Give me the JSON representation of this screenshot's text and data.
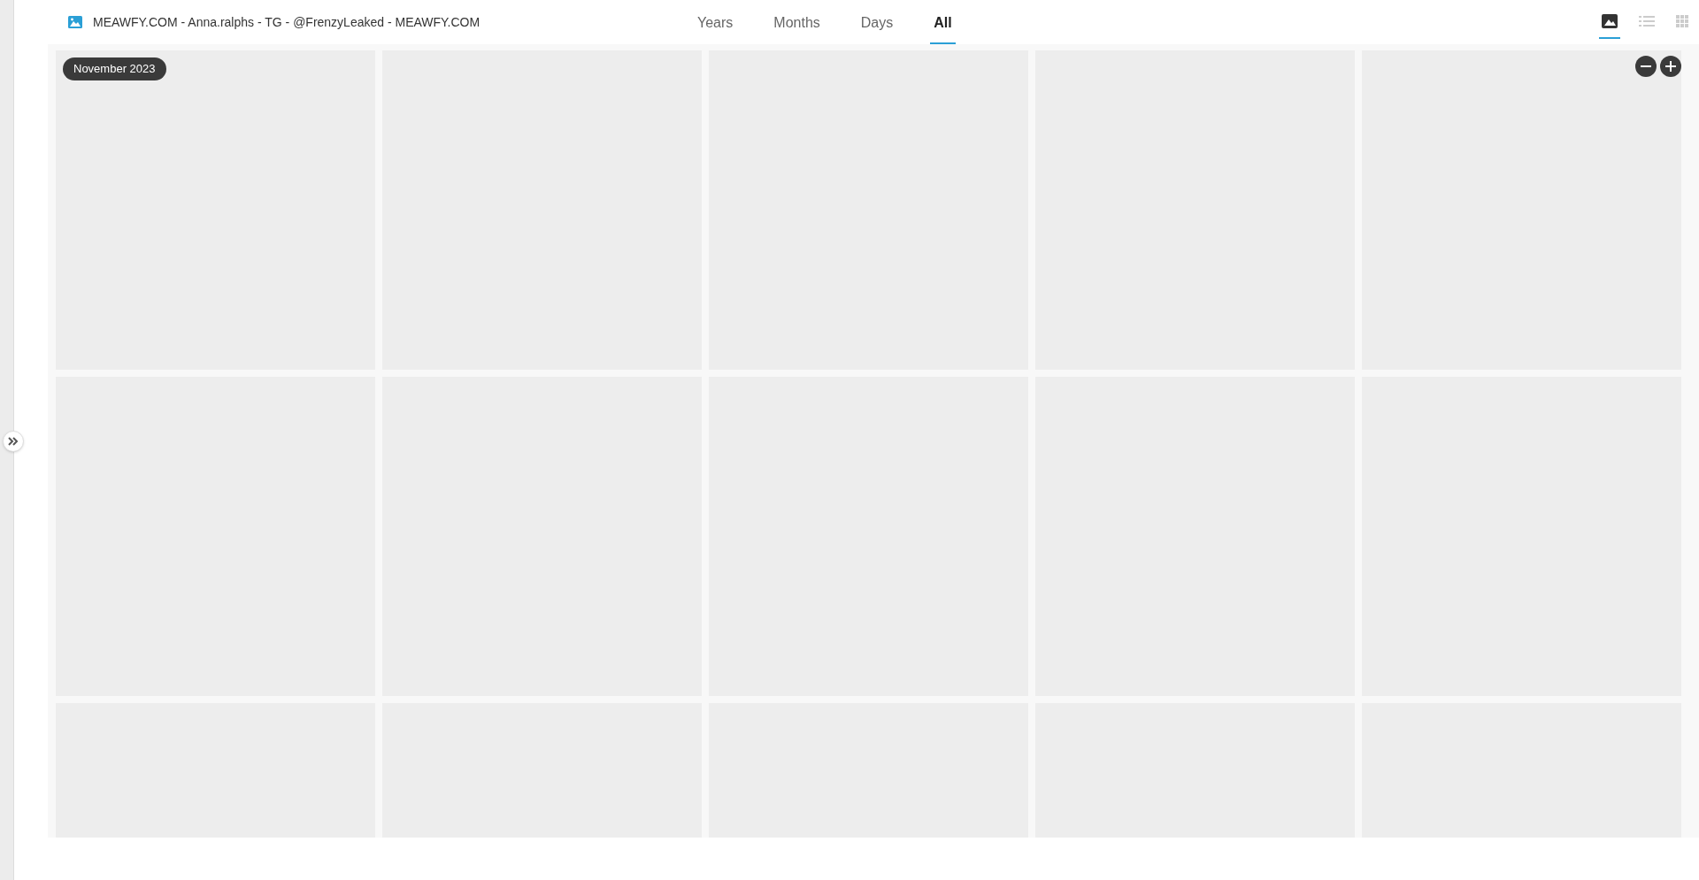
{
  "header": {
    "title": "MEAWFY.COM - Anna.ralphs - TG - @FrenzyLeaked - MEAWFY.COM"
  },
  "tabs": [
    {
      "label": "Years",
      "selected": false
    },
    {
      "label": "Months",
      "selected": false
    },
    {
      "label": "Days",
      "selected": false
    },
    {
      "label": "All",
      "selected": true
    }
  ],
  "view_modes": [
    {
      "kind": "photo",
      "selected": true
    },
    {
      "kind": "list",
      "selected": false
    },
    {
      "kind": "grid",
      "selected": false
    }
  ],
  "date_badge": "November 2023",
  "tiles": [
    {
      "kind": "placeholder"
    },
    {
      "kind": "placeholder"
    },
    {
      "kind": "placeholder"
    },
    {
      "kind": "placeholder"
    },
    {
      "kind": "placeholder"
    },
    {
      "kind": "placeholder"
    },
    {
      "kind": "placeholder"
    },
    {
      "kind": "placeholder"
    },
    {
      "kind": "placeholder"
    },
    {
      "kind": "placeholder"
    },
    {
      "kind": "placeholder"
    },
    {
      "kind": "placeholder"
    },
    {
      "kind": "placeholder"
    },
    {
      "kind": "placeholder"
    },
    {
      "kind": "placeholder"
    }
  ]
}
